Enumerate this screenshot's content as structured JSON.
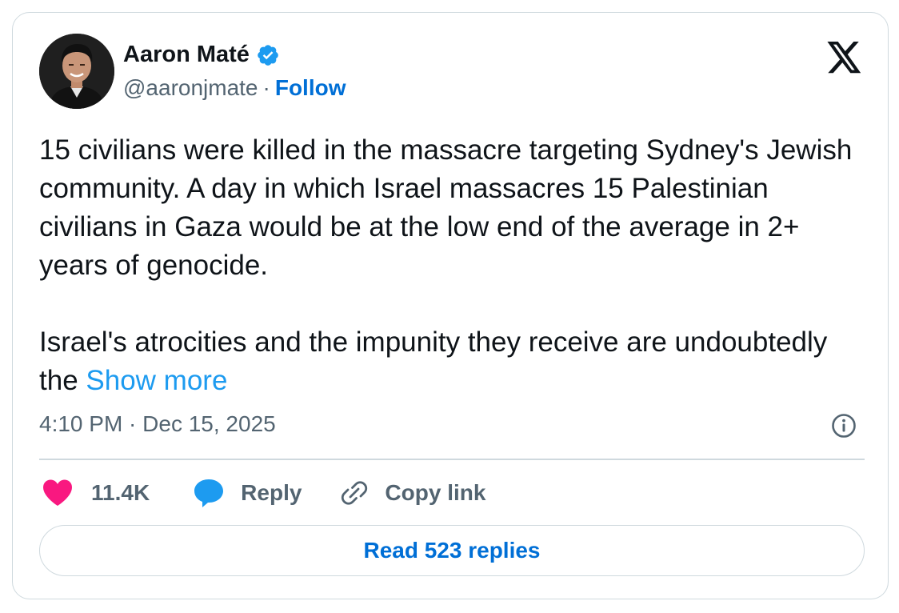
{
  "author": {
    "name": "Aaron Maté",
    "handle": "@aaronjmate",
    "separator": "·",
    "follow_label": "Follow",
    "verified": true
  },
  "tweet": {
    "text": "15 civilians were killed in the massacre targeting Sydney's Jewish community. A day in which Israel massacres 15 Palestinian civilians in Gaza would be at the low end of the average in 2+ years of genocide.\n\nIsrael's atrocities and the impunity they receive are undoubtedly the ",
    "show_more_label": "Show more",
    "timestamp": "4:10 PM · Dec 15, 2025"
  },
  "actions": {
    "like_count": "11.4K",
    "reply_label": "Reply",
    "copy_link_label": "Copy link"
  },
  "read_replies_label": "Read 523 replies",
  "icons": {
    "logo": "x-logo-icon",
    "verified": "verified-badge-icon",
    "info": "info-icon",
    "like": "heart-icon",
    "reply": "reply-bubble-icon",
    "copy": "link-icon"
  },
  "colors": {
    "text": "#0f1419",
    "secondary": "#536471",
    "link": "#1d9bf0",
    "follow": "#006fd6",
    "heart": "#f91880",
    "reply_bubble": "#1d9bf0",
    "verified": "#1d9bf0",
    "border": "#cfd9de"
  }
}
